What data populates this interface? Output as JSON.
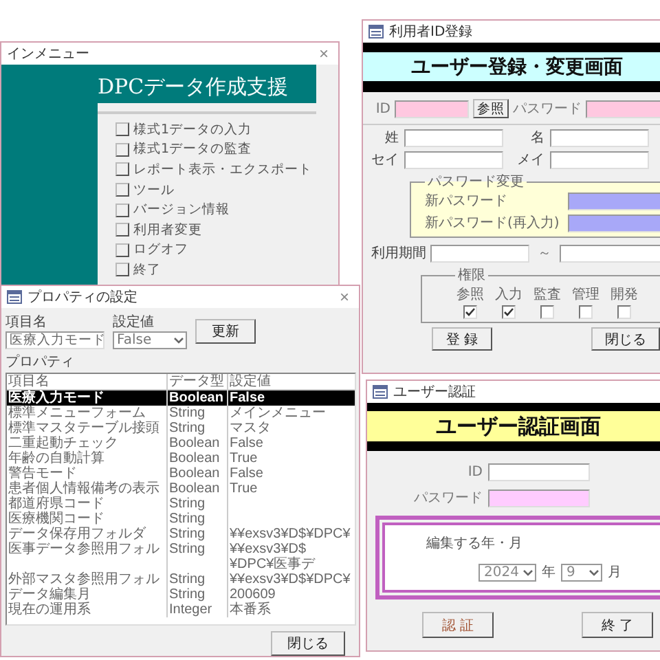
{
  "main_menu": {
    "title": "インメニュー",
    "close": "×",
    "heading": "DPCデータ作成支援",
    "items": [
      "様式1データの入力",
      "様式1データの監査",
      "レポート表示・エクスポート",
      "ツール",
      "バージョン情報",
      "利用者変更",
      "ログオフ",
      "終了"
    ]
  },
  "user_registration": {
    "title": "利用者ID登録",
    "heading": "ユーザー登録・変更画面",
    "id_label": "ID",
    "reference_button": "参照",
    "password_label": "パスワード",
    "last_name_label": "姓",
    "first_name_label": "名",
    "last_kana_label": "セイ",
    "first_kana_label": "メイ",
    "password_change": {
      "legend": "パスワード変更",
      "new_password_label": "新パスワード",
      "confirm_label": "新パスワード(再入力)"
    },
    "period_label": "利用期間",
    "period_separator": "～",
    "permissions": {
      "legend": "権限",
      "items": [
        {
          "label": "参照",
          "checked": true
        },
        {
          "label": "入力",
          "checked": true
        },
        {
          "label": "監査",
          "checked": false
        },
        {
          "label": "管理",
          "checked": false
        },
        {
          "label": "開発",
          "checked": false
        }
      ]
    },
    "buttons": [
      "登 録",
      "閉じる"
    ]
  },
  "property_settings": {
    "title": "プロパティの設定",
    "close": "×",
    "item_name_label": "項目名",
    "item_name_value": "医療入力モード",
    "setting_label": "設定値",
    "setting_value": "False",
    "update_button": "更新",
    "list_label": "プロパティ",
    "columns": [
      "項目名",
      "データ型",
      "設定値"
    ],
    "rows": [
      {
        "name": "医療入力モード",
        "type": "Boolean",
        "value": "False",
        "selected": true
      },
      {
        "name": "標準メニューフォーム",
        "type": "String",
        "value": "メインメニュー",
        "selected": false
      },
      {
        "name": "標準マスタテーブル接頭",
        "type": "String",
        "value": "マスタ",
        "selected": false
      },
      {
        "name": "二重起動チェック",
        "type": "Boolean",
        "value": "False",
        "selected": false
      },
      {
        "name": "年齢の自動計算",
        "type": "Boolean",
        "value": "True",
        "selected": false
      },
      {
        "name": "警告モード",
        "type": "Boolean",
        "value": "False",
        "selected": false
      },
      {
        "name": "患者個人情報備考の表示",
        "type": "Boolean",
        "value": "True",
        "selected": false
      },
      {
        "name": "都道府県コード",
        "type": "String",
        "selected": false
      },
      {
        "name": "医療機関コード",
        "type": "String",
        "selected": false
      },
      {
        "name": "データ保存用フォルダ",
        "type": "String",
        "value": "¥¥exsv3¥D$¥DPC¥",
        "selected": false
      },
      {
        "name": "医事データ参照用フォル",
        "type": "String",
        "value": "¥¥exsv3¥D$¥DPC¥医事デ",
        "selected": false
      },
      {
        "name": "外部マスタ参照用フォル",
        "type": "String",
        "value": "¥¥exsv3¥D$¥DPC¥",
        "selected": false
      },
      {
        "name": "データ編集月",
        "type": "String",
        "value": "200609",
        "selected": false
      },
      {
        "name": "現在の運用系",
        "type": "Integer",
        "value": "本番系",
        "selected": false
      }
    ],
    "close_button": "閉じる"
  },
  "user_auth": {
    "title": "ユーザー認証",
    "heading": "ユーザー認証画面",
    "id_label": "ID",
    "password_label": "パスワード",
    "period": {
      "label": "編集する年・月",
      "year": "2024",
      "year_unit": "年",
      "month": "9",
      "month_unit": "月"
    },
    "buttons": [
      "認 証",
      "終 了"
    ]
  }
}
